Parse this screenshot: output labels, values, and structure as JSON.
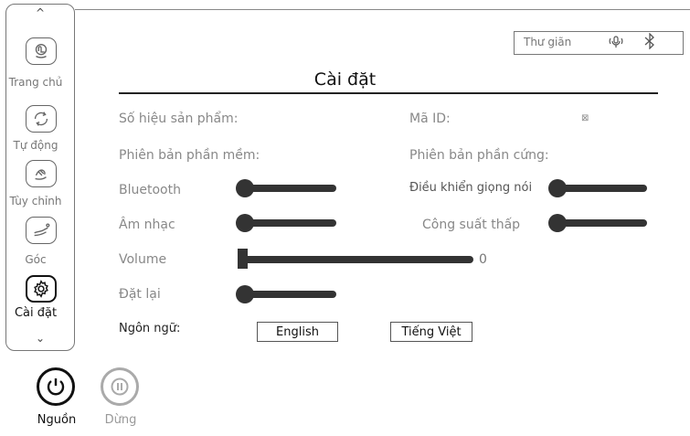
{
  "sidebar": {
    "items": [
      {
        "label": "Trang chủ",
        "icon": "hand-tap-icon"
      },
      {
        "label": "Tự động",
        "icon": "auto-cycle-icon"
      },
      {
        "label": "Tùy chỉnh",
        "icon": "custom-hand-icon"
      },
      {
        "label": "Góc",
        "icon": "recline-angle-icon"
      },
      {
        "label": "Cài đặt",
        "icon": "gear-icon",
        "active": true
      }
    ]
  },
  "status": {
    "mode": "Thư giãn",
    "mic_icon": "voice-icon",
    "bt_icon": "bluetooth-icon"
  },
  "page": {
    "title": "Cài đặt"
  },
  "info": {
    "product_number_label": "Số hiệu sản phẩm:",
    "id_label": "Mã ID:",
    "id_value": "⊠",
    "software_version_label": "Phiên bản phần mềm:",
    "hardware_version_label": "Phiên bản phần cứng:"
  },
  "settings": {
    "bluetooth_label": "Bluetooth",
    "voice_control_label": "Điều khiển giọng nói",
    "music_label": "Âm nhạc",
    "low_power_label": "Công suất thấp",
    "volume_label": "Volume",
    "volume_value": "0",
    "reset_label": "Đặt lại",
    "language_label": "Ngôn ngữ:",
    "lang_english": "English",
    "lang_vietnamese": "Tiếng Việt"
  },
  "controls": {
    "power_label": "Nguồn",
    "pause_label": "Dừng"
  }
}
